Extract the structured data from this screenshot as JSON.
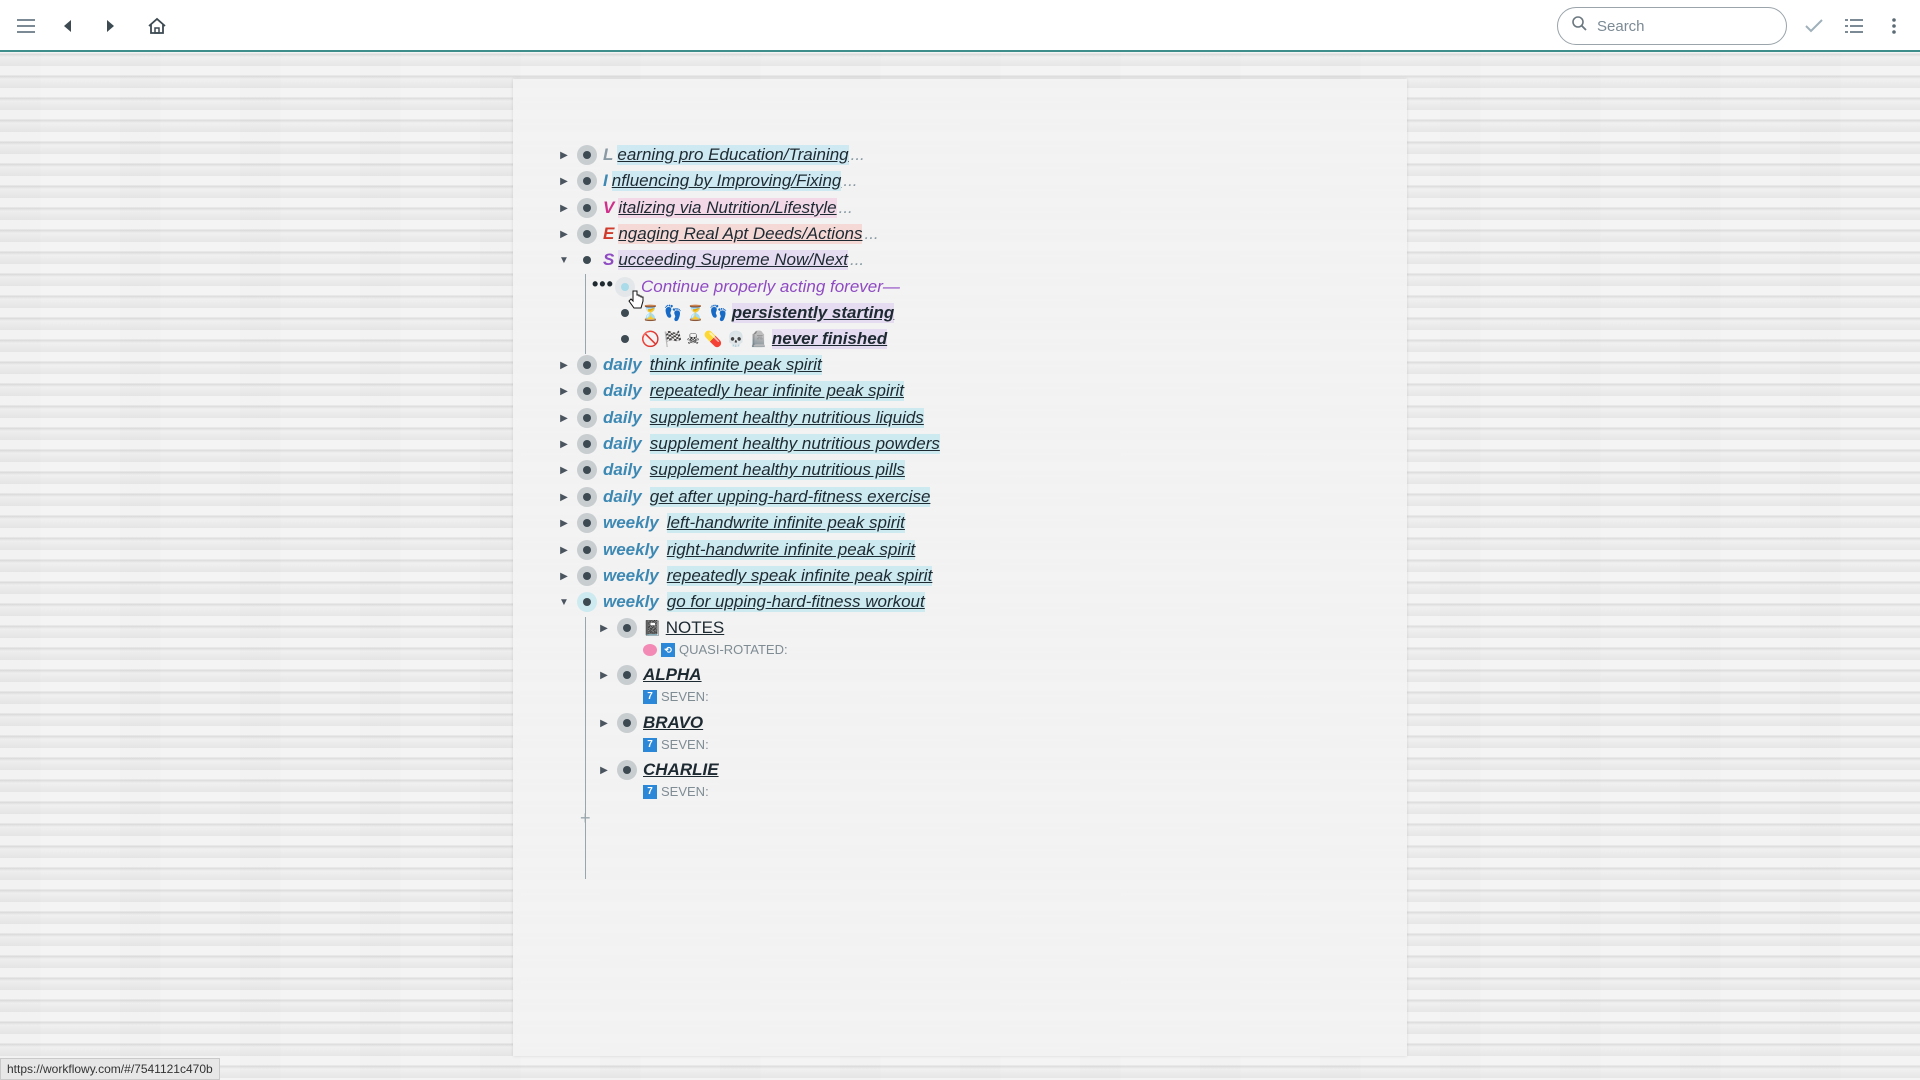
{
  "topbar": {
    "search_placeholder": "Search",
    "icons": [
      "menu-icon",
      "back-icon",
      "forward-icon",
      "home-icon",
      "check-icon",
      "list-icon",
      "more-icon"
    ]
  },
  "outline": {
    "items": [
      {
        "letter": "L",
        "text": "earning pro Education/Training",
        "ellipsis": "..."
      },
      {
        "letter": "I",
        "text": "nfluencing by Improving/Fixing",
        "ellipsis": "..."
      },
      {
        "letter": "V",
        "text": "italizing via Nutrition/Lifestyle",
        "ellipsis": "..."
      },
      {
        "letter": "E",
        "text": "ngaging Real Apt Deeds/Actions",
        "ellipsis": "..."
      },
      {
        "letter": "S",
        "text": "ucceeding Supreme Now/Next",
        "ellipsis": "..."
      }
    ],
    "s_children": {
      "continue": "Continue properly acting forever—",
      "persist": "persistently starting",
      "never": "never finished"
    },
    "tasks": [
      {
        "freq": "daily",
        "text": "think infinite peak spirit"
      },
      {
        "freq": "daily",
        "text": "repeatedly hear infinite peak spirit"
      },
      {
        "freq": "daily",
        "text": "supplement healthy nutritious liquids"
      },
      {
        "freq": "daily",
        "text": "supplement healthy nutritious powders"
      },
      {
        "freq": "daily",
        "text": "supplement healthy nutritious pills"
      },
      {
        "freq": "daily",
        "text": "get after upping-hard-fitness exercise"
      },
      {
        "freq": "weekly",
        "text": "left-handwrite infinite peak spirit"
      },
      {
        "freq": "weekly",
        "text": "right-handwrite infinite peak spirit"
      },
      {
        "freq": "weekly",
        "text": "repeatedly speak infinite peak spirit"
      },
      {
        "freq": "weekly",
        "text": "go for upping-hard-fitness workout"
      }
    ],
    "workout_children": [
      {
        "title": "NOTES",
        "note": "QUASI-ROTATED:"
      },
      {
        "title": "ALPHA",
        "note": "SEVEN:"
      },
      {
        "title": "BRAVO",
        "note": "SEVEN:"
      },
      {
        "title": "CHARLIE",
        "note": "SEVEN:"
      }
    ]
  },
  "statusbar": {
    "url": "https://workflowy.com/#/7541121c470b"
  }
}
